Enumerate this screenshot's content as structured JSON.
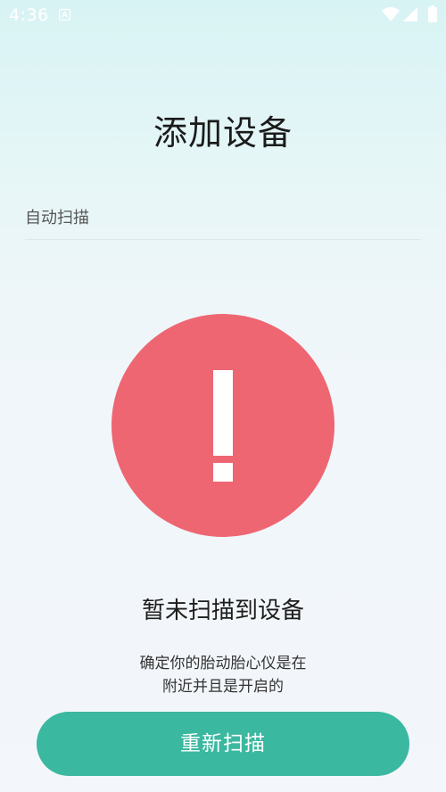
{
  "status_bar": {
    "time": "4:36",
    "icons": [
      "notification-icon",
      "wifi-icon",
      "signal-icon",
      "battery-icon"
    ]
  },
  "page": {
    "title": "添加设备",
    "scan_mode_label": "自动扫描"
  },
  "result": {
    "icon": "alert-icon",
    "title": "暂未扫描到设备",
    "hint_line1": "确定你的胎动胎心仪是在",
    "hint_line2": "附近并且是开启的"
  },
  "actions": {
    "rescan_label": "重新扫描"
  },
  "colors": {
    "accent": "#3bb8a0",
    "alert": "#ee6672",
    "background_top": "#d8f3f4",
    "background_bottom": "#f3f6fa"
  }
}
